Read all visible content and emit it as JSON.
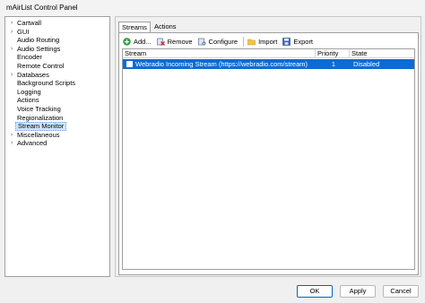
{
  "window": {
    "title": "mAirList Control Panel"
  },
  "tree": {
    "items": [
      {
        "label": "Cartwall",
        "expandable": true
      },
      {
        "label": "GUI",
        "expandable": true
      },
      {
        "label": "Audio Routing",
        "expandable": false
      },
      {
        "label": "Audio Settings",
        "expandable": true
      },
      {
        "label": "Encoder",
        "expandable": false
      },
      {
        "label": "Remote Control",
        "expandable": false
      },
      {
        "label": "Databases",
        "expandable": true
      },
      {
        "label": "Background Scripts",
        "expandable": false
      },
      {
        "label": "Logging",
        "expandable": false
      },
      {
        "label": "Actions",
        "expandable": false
      },
      {
        "label": "Voice Tracking",
        "expandable": false
      },
      {
        "label": "Regionalization",
        "expandable": false
      },
      {
        "label": "Stream Monitor",
        "expandable": false,
        "selected": true
      },
      {
        "label": "Miscellaneous",
        "expandable": true
      },
      {
        "label": "Advanced",
        "expandable": true
      }
    ]
  },
  "tabs": [
    {
      "label": "Streams",
      "active": true
    },
    {
      "label": "Actions",
      "active": false
    }
  ],
  "toolbar": {
    "add": "Add...",
    "remove": "Remove",
    "configure": "Configure",
    "import": "Import",
    "export": "Export"
  },
  "grid": {
    "columns": [
      "Stream",
      "Priority",
      "State"
    ],
    "rows": [
      {
        "stream": "Webradio Incoming Stream (https://webradio.com/stream)",
        "priority": "1",
        "state": "Disabled",
        "selected": true
      }
    ]
  },
  "buttons": {
    "ok": "OK",
    "apply": "Apply",
    "cancel": "Cancel"
  },
  "colors": {
    "selection": "#0a6cd6",
    "tree_selection": "#cce8ff"
  }
}
